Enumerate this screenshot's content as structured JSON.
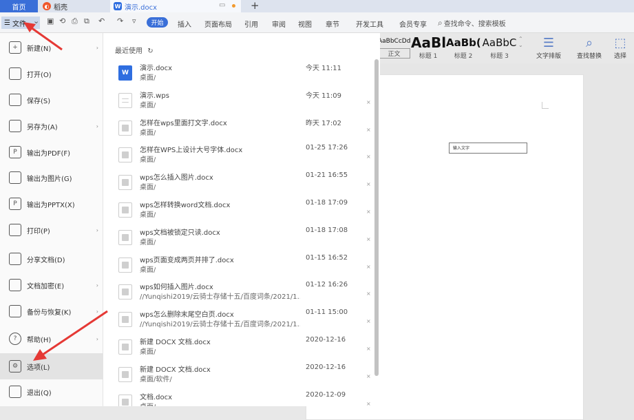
{
  "titlebar": {
    "home_tab": "首页",
    "daoke_tab": "稻壳",
    "doc_tab": "演示.docx"
  },
  "ribbon": {
    "file_button": "文件",
    "start_tab": "开始",
    "tabs": [
      "插入",
      "页面布局",
      "引用",
      "审阅",
      "视图",
      "章节",
      "开发工具",
      "会员专享"
    ],
    "search_placeholder": "查找命令、搜索模板",
    "styles": [
      {
        "preview": "AaBbCcDd",
        "label": "正文"
      },
      {
        "preview": "AaBl",
        "label": "标题 1"
      },
      {
        "preview": "AaBb(",
        "label": "标题 2"
      },
      {
        "preview": "AaBbC",
        "label": "标题 3"
      }
    ],
    "tools": [
      "文字排版",
      "查找替换",
      "选择"
    ]
  },
  "file_menu": {
    "items": [
      {
        "label": "新建(N)",
        "icon": "new-doc-icon",
        "glyph": "+",
        "arrow": true
      },
      {
        "label": "打开(O)",
        "icon": "folder-open-icon",
        "glyph": "",
        "arrow": false
      },
      {
        "label": "保存(S)",
        "icon": "save-icon",
        "glyph": "",
        "arrow": false
      },
      {
        "label": "另存为(A)",
        "icon": "save-as-icon",
        "glyph": "",
        "arrow": true
      },
      {
        "label": "输出为PDF(F)",
        "icon": "pdf-export-icon",
        "glyph": "P",
        "arrow": false
      },
      {
        "label": "输出为图片(G)",
        "icon": "image-export-icon",
        "glyph": "",
        "arrow": false
      },
      {
        "label": "输出为PPTX(X)",
        "icon": "pptx-export-icon",
        "glyph": "P",
        "arrow": false
      },
      {
        "label": "打印(P)",
        "icon": "printer-icon",
        "glyph": "",
        "arrow": true
      },
      {
        "label": "分享文档(D)",
        "icon": "share-icon",
        "glyph": "",
        "arrow": false
      },
      {
        "label": "文档加密(E)",
        "icon": "lock-doc-icon",
        "glyph": "",
        "arrow": true
      },
      {
        "label": "备份与恢复(K)",
        "icon": "backup-icon",
        "glyph": "",
        "arrow": true
      },
      {
        "label": "帮助(H)",
        "icon": "help-icon",
        "glyph": "?",
        "arrow": true
      },
      {
        "label": "选项(L)",
        "icon": "gear-icon",
        "glyph": "⚙",
        "arrow": false
      },
      {
        "label": "退出(Q)",
        "icon": "exit-icon",
        "glyph": "",
        "arrow": false
      }
    ]
  },
  "recent": {
    "header": "最近使用",
    "files": [
      {
        "name": "演示.docx",
        "path": "桌面/",
        "time": "今天 11:11",
        "type": "docx"
      },
      {
        "name": "演示.wps",
        "path": "桌面/",
        "time": "今天 11:09",
        "type": "wps"
      },
      {
        "name": "怎样在wps里面打文字.docx",
        "path": "桌面/",
        "time": "昨天 17:02",
        "type": "gray"
      },
      {
        "name": "怎样在WPS上设计大号字体.docx",
        "path": "桌面/",
        "time": "01-25 17:26",
        "type": "gray"
      },
      {
        "name": "wps怎么插入图片.docx",
        "path": "桌面/",
        "time": "01-21 16:55",
        "type": "gray"
      },
      {
        "name": "wps怎样转换word文档.docx",
        "path": "桌面/",
        "time": "01-18 17:09",
        "type": "gray"
      },
      {
        "name": "wps文档被锁定只读.docx",
        "path": "桌面/",
        "time": "01-18 17:08",
        "type": "gray"
      },
      {
        "name": "wps页面变成两页并排了.docx",
        "path": "桌面/",
        "time": "01-15 16:52",
        "type": "gray"
      },
      {
        "name": "wps如何插入图片.docx",
        "path": "//Yunqishi2019/云骑士存储十五/百度词条/2021/1...",
        "time": "01-12 16:26",
        "type": "gray"
      },
      {
        "name": "wps怎么删除末尾空白页.docx",
        "path": "//Yunqishi2019/云骑士存储十五/百度词条/2021/1...",
        "time": "01-11 15:00",
        "type": "gray"
      },
      {
        "name": "新建 DOCX 文档.docx",
        "path": "桌面/",
        "time": "2020-12-16",
        "type": "gray"
      },
      {
        "name": "新建 DOCX 文档.docx",
        "path": "桌面/软件/",
        "time": "2020-12-16",
        "type": "gray"
      },
      {
        "name": "文档.docx",
        "path": "桌面/",
        "time": "2020-12-09",
        "type": "gray"
      }
    ]
  },
  "document": {
    "textbox_placeholder": "输入文字"
  },
  "colors": {
    "accent": "#3a6fd8",
    "annotation_arrow": "#e53935"
  }
}
